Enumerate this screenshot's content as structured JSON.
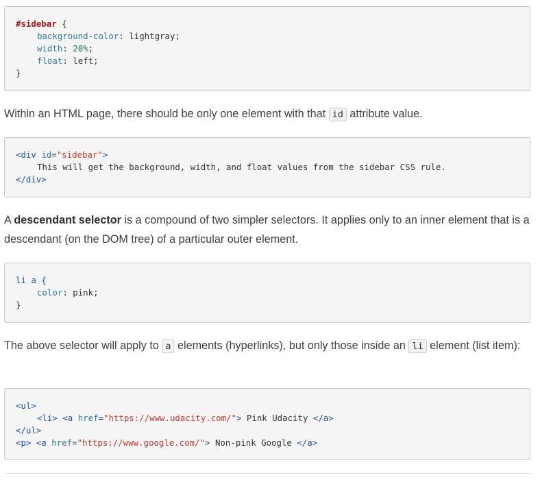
{
  "code1": {
    "selector": "#sidebar",
    "open_brace": " {",
    "prop1": "background-color",
    "val1": " lightgray;",
    "prop2": "width",
    "val2": " 20%",
    "val2_end": ";",
    "prop3": "float",
    "val3": " left;",
    "close_brace": "}"
  },
  "para1": {
    "before": "Within an HTML page, there should be only one element with that ",
    "code": "id",
    "after": " attribute value."
  },
  "code2": {
    "tag_open": "<div ",
    "attr": "id",
    "eq": "=",
    "str": "\"sidebar\"",
    "tag_close": ">",
    "content": "This will get the background, width, and float values from the sidebar CSS rule.",
    "end_tag": "</div>"
  },
  "para2": {
    "lead": "A ",
    "bold": "descendant selector",
    "rest": " is a compound of two simpler selectors. It applies only to an inner element that is a descendant (on the DOM tree) of a particular outer element."
  },
  "code3": {
    "selector": "li a {",
    "prop": "color",
    "val": " pink;",
    "close_brace": "}"
  },
  "para3": {
    "before": "The above selector will apply to ",
    "code_a": "a",
    "middle": " elements (hyperlinks), but only those inside an ",
    "code_li": "li",
    "after": " element (list item):"
  },
  "code4": {
    "ul_open": "<ul>",
    "li_open": "<li>",
    "a_open": " <a ",
    "href_attr": "href",
    "eq": "=",
    "url1": "\"https://www.udacity.com/\"",
    "a_gt": ">",
    "link1_text": " Pink Udacity ",
    "a_close": "</a>",
    "ul_close": "</ul>",
    "p_open": "<p>",
    "url2": "\"https://www.google.com/\"",
    "link2_text": " Non-pink Google "
  }
}
